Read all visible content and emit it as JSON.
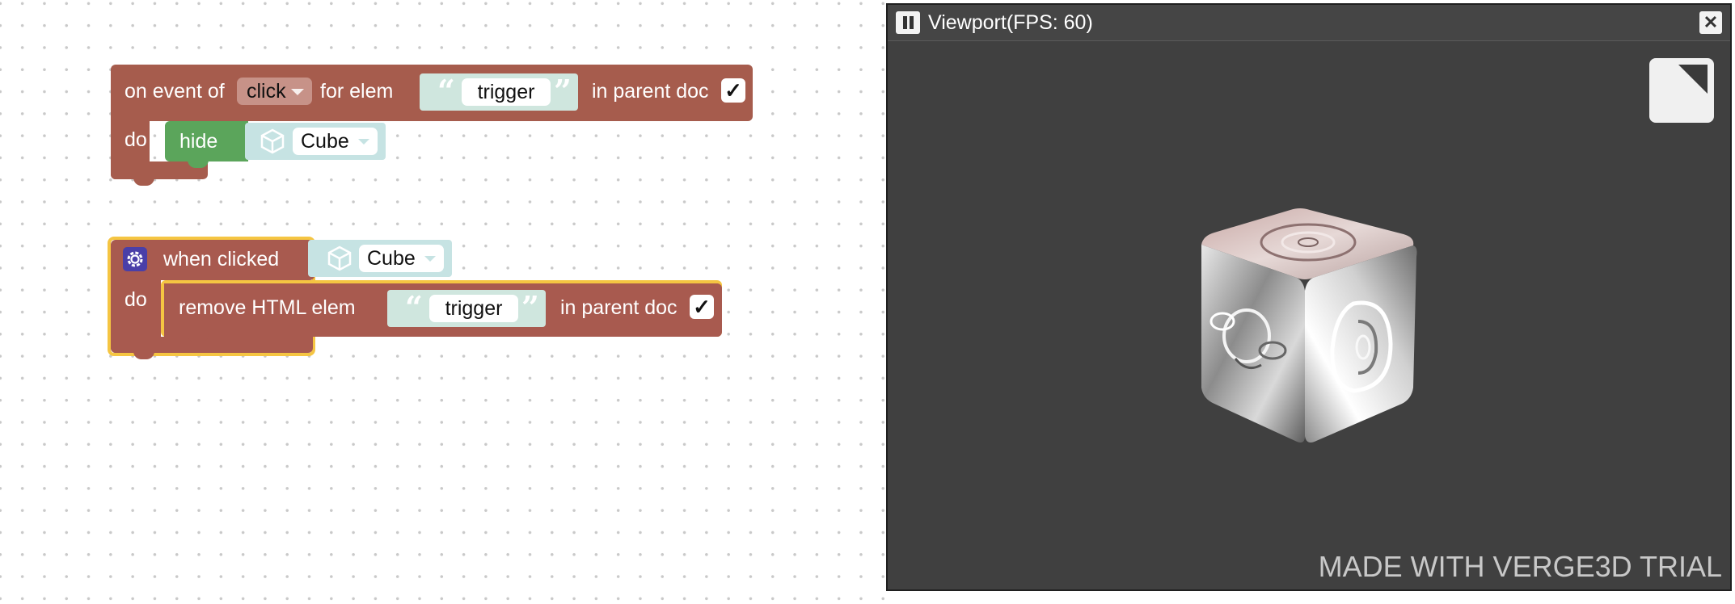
{
  "workspace": {
    "block1": {
      "on_event_of": "on event of",
      "event": "click",
      "for_elem": "for elem",
      "elem_text": "trigger",
      "in_parent_doc": "in parent doc",
      "checkbox": "✓",
      "do": "do",
      "action": "hide",
      "object": "Cube"
    },
    "block2": {
      "when_clicked": "when clicked",
      "object": "Cube",
      "do": "do",
      "remove_html_elem": "remove HTML elem",
      "elem_text": "trigger",
      "in_parent_doc": "in parent doc",
      "checkbox": "✓"
    },
    "quote_open": "“",
    "quote_close": "”"
  },
  "viewport": {
    "title": "Viewport(FPS: 60)",
    "close_glyph": "✕",
    "watermark": "MADE WITH VERGE3D TRIAL"
  },
  "colors": {
    "event_block": "#a65c4d",
    "action_block": "#5ba55b",
    "text_block": "#cfe6de",
    "object_block": "#c6e3e3",
    "selected_outline": "#f5c542",
    "viewport_bg": "#404040"
  },
  "icons": {
    "gear": "gear-icon",
    "cube": "cube-icon",
    "pause": "pause-icon",
    "close": "close-icon",
    "fullscreen": "fullscreen-icon"
  }
}
